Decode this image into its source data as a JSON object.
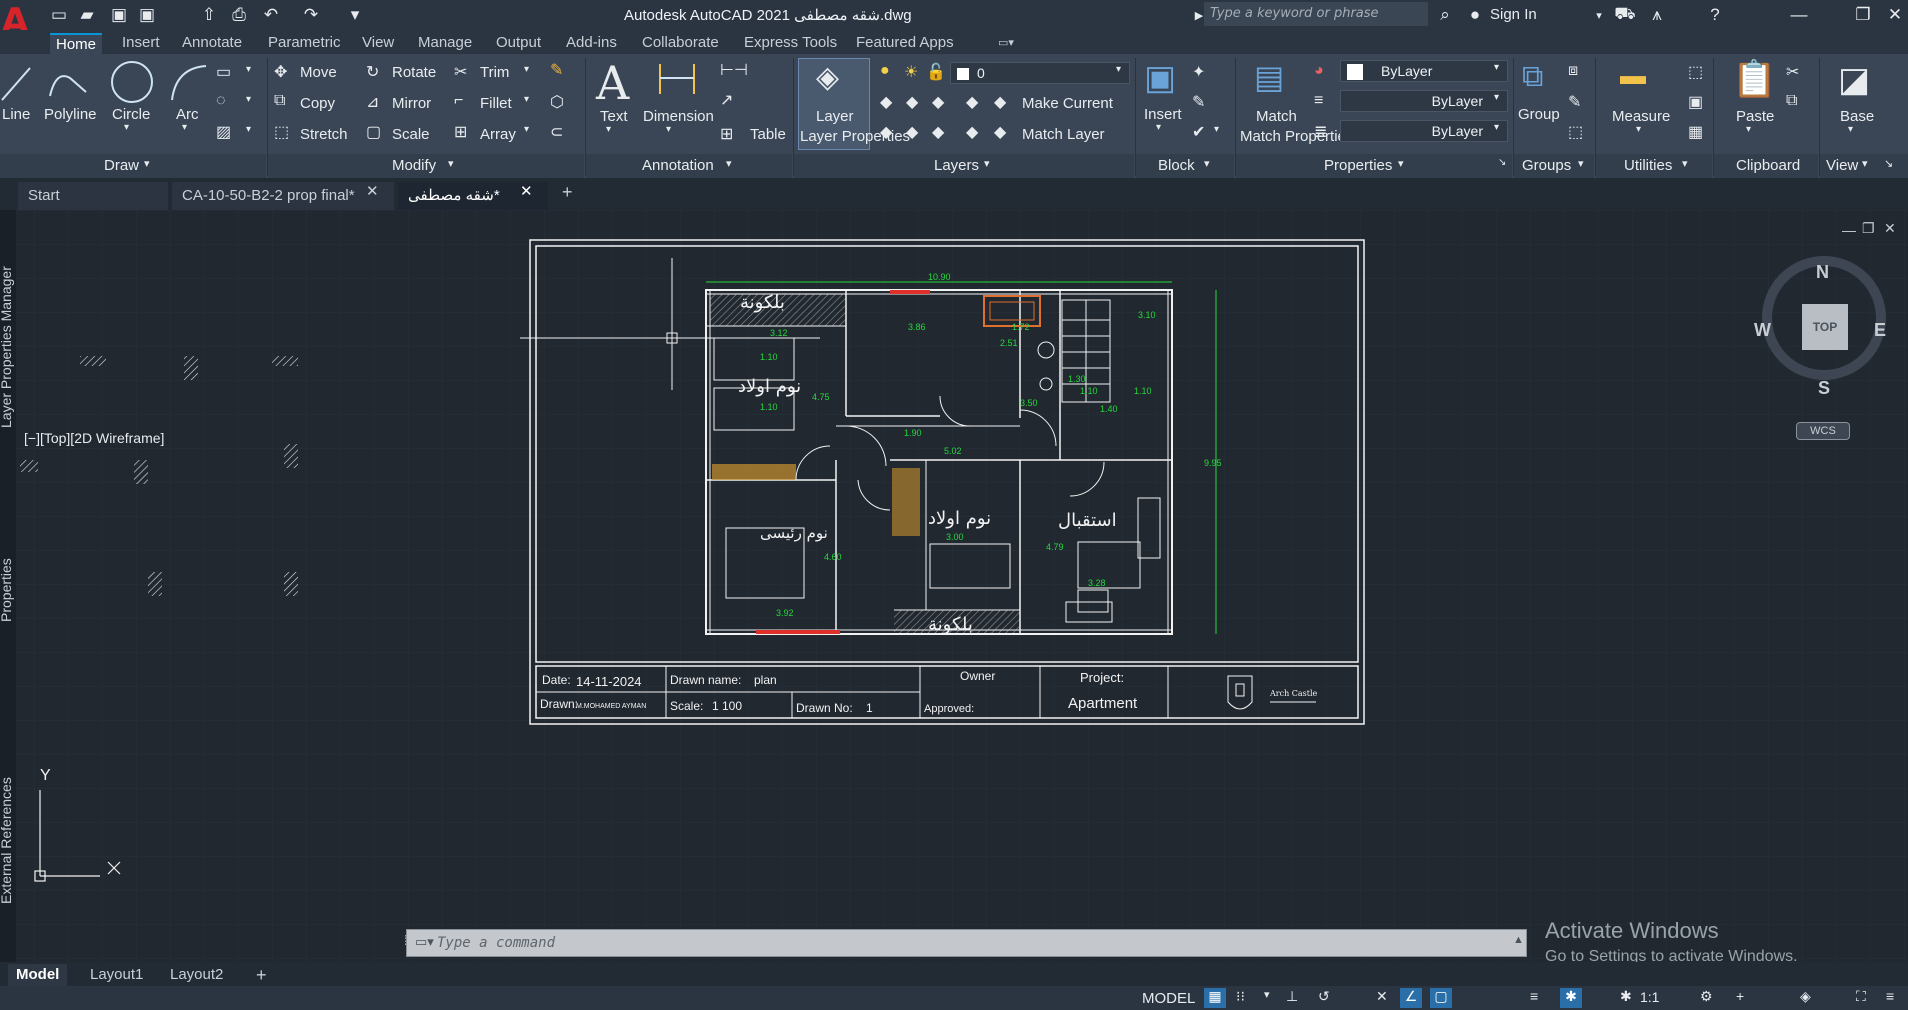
{
  "titlebar": {
    "title": "Autodesk AutoCAD 2021   شقه مصطفى.dwg",
    "search_placeholder": "Type a keyword or phrase",
    "sign_in": "Sign In",
    "logo": "A"
  },
  "ribbon_tabs": [
    "Home",
    "Insert",
    "Annotate",
    "Parametric",
    "View",
    "Manage",
    "Output",
    "Add-ins",
    "Collaborate",
    "Express Tools",
    "Featured Apps"
  ],
  "draw": {
    "line": "Line",
    "polyline": "Polyline",
    "circle": "Circle",
    "arc": "Arc",
    "title": "Draw"
  },
  "modify": {
    "move": "Move",
    "rotate": "Rotate",
    "trim": "Trim",
    "copy": "Copy",
    "mirror": "Mirror",
    "fillet": "Fillet",
    "stretch": "Stretch",
    "scale": "Scale",
    "array": "Array",
    "title": "Modify"
  },
  "annotation": {
    "text": "Text",
    "dimension": "Dimension",
    "table": "Table",
    "title": "Annotation"
  },
  "layers": {
    "layer_properties": "Layer Properties",
    "current_layer": "0",
    "make_current": "Make Current",
    "match_layer": "Match Layer",
    "title": "Layers"
  },
  "block": {
    "insert": "Insert",
    "title": "Block"
  },
  "properties": {
    "match_properties": "Match Properties",
    "bylayer1": "ByLayer",
    "bylayer2": "ByLayer",
    "bylayer3": "ByLayer",
    "title": "Properties"
  },
  "groups": {
    "group": "Group",
    "title": "Groups"
  },
  "utilities": {
    "measure": "Measure",
    "title": "Utilities"
  },
  "clipboard": {
    "paste": "Paste",
    "title": "Clipboard"
  },
  "view": {
    "base": "Base",
    "title": "View"
  },
  "doc_tabs": [
    "Start",
    "CA-10-50-B2-2 prop final*",
    "شقه مصطفى*"
  ],
  "viewport_label": "[−][Top][2D Wireframe]",
  "left_palettes": [
    "Layer Properties Manager",
    "Properties",
    "External References"
  ],
  "viewcube": {
    "n": "N",
    "s": "S",
    "e": "E",
    "w": "W",
    "top": "TOP",
    "wcs": "WCS"
  },
  "ucs": {
    "y": "Y"
  },
  "plan": {
    "rooms": [
      "بلكونة",
      "نوم اولاد",
      "نوم رئيسى",
      "نوم اولاد",
      "استقبال",
      "بلكونة"
    ],
    "dims": [
      "10.90",
      "3.12",
      "3.86",
      "1.72",
      "3.10",
      "4.75",
      "1.10",
      "1.10",
      "5.02",
      "1.90",
      "3.00",
      "4.79",
      "3.28",
      "3.92",
      "4.60",
      "9.95",
      "2.51",
      "3.50",
      "1.30",
      "1.40",
      "1.10",
      "1.10"
    ]
  },
  "titleblock": {
    "date_label": "Date:",
    "date": "14-11-2024",
    "drawn_name_label": "Drawn name:",
    "drawn_name": "plan",
    "owner_label": "Owner",
    "project_label": "Project:",
    "project": "Apartment",
    "drawn_label": "Drawn:",
    "drawn": "M.MOHAMED AYMAN",
    "scale_label": "Scale:",
    "scale": "1  100",
    "drawn_no_label": "Drawn No:",
    "drawn_no": "1",
    "approved_label": "Approved:",
    "logo_text": "Arch Castle"
  },
  "command": {
    "placeholder": "Type a command"
  },
  "layout_tabs": [
    "Model",
    "Layout1",
    "Layout2"
  ],
  "watermark": {
    "line1": "Activate Windows",
    "line2": "Go to Settings to activate Windows."
  },
  "status": {
    "model": "MODEL",
    "scale": "1:1"
  }
}
